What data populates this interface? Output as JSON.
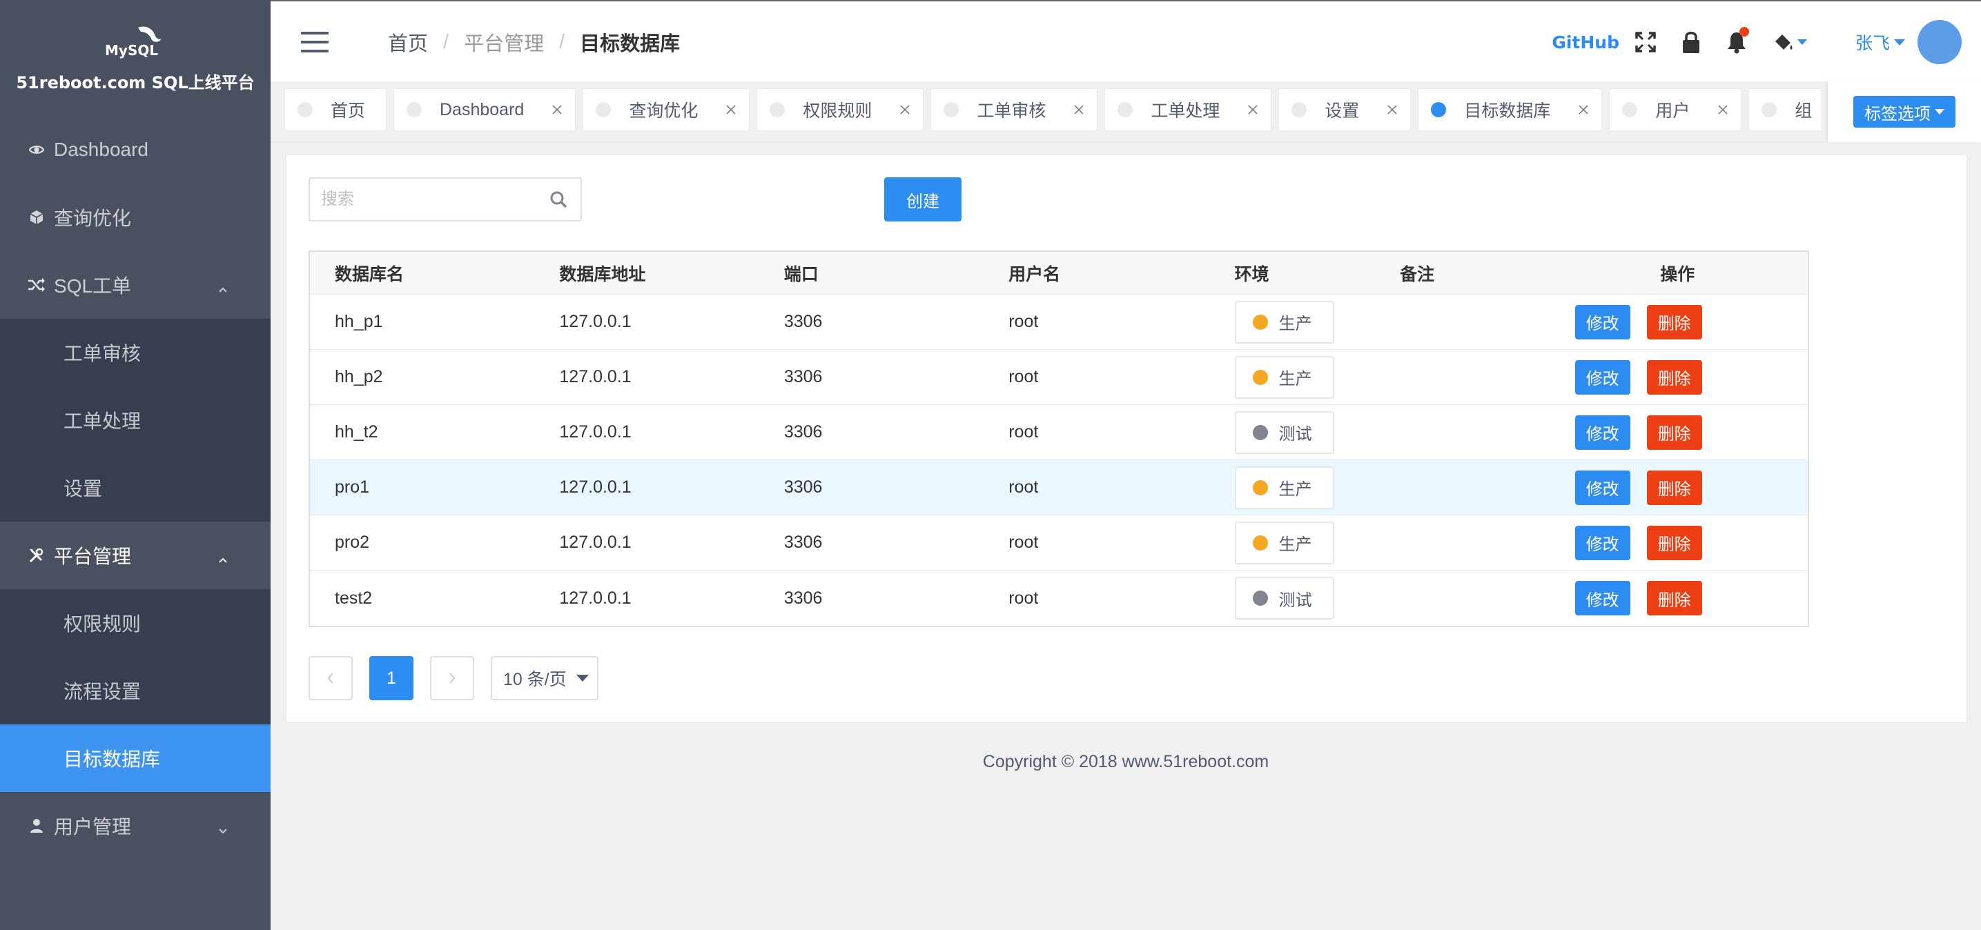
{
  "sidebar": {
    "logo_title": "51reboot.com SQL上线平台",
    "logo_text": "MySQL",
    "items": [
      {
        "label": "Dashboard",
        "icon": "eye-icon"
      },
      {
        "label": "查询优化",
        "icon": "cube-icon"
      },
      {
        "label": "SQL工单",
        "icon": "shuffle-icon",
        "expanded": true,
        "children": [
          {
            "label": "工单审核"
          },
          {
            "label": "工单处理"
          },
          {
            "label": "设置"
          }
        ]
      },
      {
        "label": "平台管理",
        "icon": "tools-icon",
        "expanded": true,
        "children": [
          {
            "label": "权限规则"
          },
          {
            "label": "流程设置"
          },
          {
            "label": "目标数据库",
            "active": true
          }
        ]
      },
      {
        "label": "用户管理",
        "icon": "person-icon",
        "expanded": false
      }
    ]
  },
  "header": {
    "breadcrumb": [
      "首页",
      "平台管理",
      "目标数据库"
    ],
    "github": "GitHub",
    "user_name": "张飞"
  },
  "tags": {
    "items": [
      {
        "label": "首页",
        "closable": false
      },
      {
        "label": "Dashboard",
        "closable": true
      },
      {
        "label": "查询优化",
        "closable": true
      },
      {
        "label": "权限规则",
        "closable": true
      },
      {
        "label": "工单审核",
        "closable": true
      },
      {
        "label": "工单处理",
        "closable": true
      },
      {
        "label": "设置",
        "closable": true
      },
      {
        "label": "目标数据库",
        "closable": true,
        "active": true
      },
      {
        "label": "用户",
        "closable": true
      },
      {
        "label": "组",
        "closable": true
      }
    ],
    "options_label": "标签选项"
  },
  "main": {
    "search_placeholder": "搜索",
    "create_label": "创建",
    "table": {
      "headers": [
        "数据库名",
        "数据库地址",
        "端口",
        "用户名",
        "环境",
        "备注",
        "操作"
      ],
      "rows": [
        {
          "name": "hh_p1",
          "host": "127.0.0.1",
          "port": "3306",
          "user": "root",
          "env": "生产",
          "env_color": "#f5a623",
          "note": ""
        },
        {
          "name": "hh_p2",
          "host": "127.0.0.1",
          "port": "3306",
          "user": "root",
          "env": "生产",
          "env_color": "#f5a623",
          "note": ""
        },
        {
          "name": "hh_t2",
          "host": "127.0.0.1",
          "port": "3306",
          "user": "root",
          "env": "测试",
          "env_color": "#80848f",
          "note": ""
        },
        {
          "name": "pro1",
          "host": "127.0.0.1",
          "port": "3306",
          "user": "root",
          "env": "生产",
          "env_color": "#f5a623",
          "note": "",
          "highlighted": true
        },
        {
          "name": "pro2",
          "host": "127.0.0.1",
          "port": "3306",
          "user": "root",
          "env": "生产",
          "env_color": "#f5a623",
          "note": ""
        },
        {
          "name": "test2",
          "host": "127.0.0.1",
          "port": "3306",
          "user": "root",
          "env": "测试",
          "env_color": "#80848f",
          "note": ""
        }
      ],
      "edit_label": "修改",
      "delete_label": "删除"
    },
    "pagination": {
      "current_page": "1",
      "page_size": "10 条/页"
    }
  },
  "footer": {
    "copyright": "Copyright © 2018 www.51reboot.com"
  },
  "colors": {
    "primary": "#2d8cf0",
    "danger": "#ed3f14",
    "sidebar_bg": "#495060",
    "sidebar_sub_bg": "#363e4f",
    "prod_dot": "#f5a623",
    "test_dot": "#80848f"
  }
}
